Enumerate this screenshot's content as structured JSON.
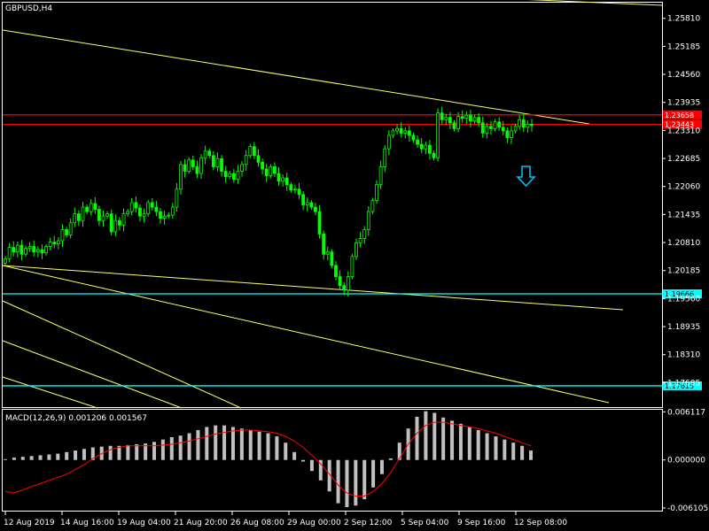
{
  "symbol_title": "GBPUSD,H4",
  "macd_label": "MACD(12,26,9) 0.001206 0.001567",
  "colors": {
    "background": "#000000",
    "frame": "#ffffff",
    "bull": "#00ff00",
    "trendline": "#ffff66",
    "resistance": "#ff0000",
    "support": "#00ffff",
    "macd_hist": "#c0c0c0",
    "macd_signal": "#ff0000",
    "signal_arrow": "#00bfff"
  },
  "chart_data": [
    {
      "type": "candlestick",
      "title": "GBPUSD,H4",
      "ylim": [
        1.1714,
        1.2616
      ],
      "price_ticks": [
        "1.25810",
        "1.25185",
        "1.24560",
        "1.23935",
        "1.23310",
        "1.22685",
        "1.22060",
        "1.21435",
        "1.20810",
        "1.20185",
        "1.19560",
        "1.18935",
        "1.18310",
        "1.17685"
      ],
      "time_ticks": [
        "12 Aug 2019",
        "14 Aug 16:00",
        "19 Aug 04:00",
        "21 Aug 20:00",
        "26 Aug 08:00",
        "29 Aug 00:00",
        "2 Sep 12:00",
        "5 Sep 04:00",
        "9 Sep 16:00",
        "12 Sep 08:00"
      ],
      "close_series": [
        1.2045,
        1.207,
        1.206,
        1.2075,
        1.2055,
        1.2068,
        1.2072,
        1.206,
        1.2065,
        1.2058,
        1.2072,
        1.2082,
        1.2078,
        1.2085,
        1.211,
        1.2098,
        1.2125,
        1.2145,
        1.213,
        1.216,
        1.215,
        1.2168,
        1.2155,
        1.213,
        1.214,
        1.2145,
        1.2105,
        1.213,
        1.212,
        1.2145,
        1.215,
        1.217,
        1.2158,
        1.214,
        1.2145,
        1.217,
        1.216,
        1.215,
        1.2135,
        1.214,
        1.2142,
        1.216,
        1.22,
        1.2255,
        1.224,
        1.2265,
        1.225,
        1.2235,
        1.227,
        1.2285,
        1.2275,
        1.225,
        1.2268,
        1.224,
        1.2228,
        1.2235,
        1.2222,
        1.224,
        1.2255,
        1.2275,
        1.2295,
        1.2275,
        1.226,
        1.2245,
        1.223,
        1.225,
        1.2235,
        1.2218,
        1.2225,
        1.221,
        1.2198,
        1.22,
        1.2188,
        1.2165,
        1.217,
        1.216,
        1.215,
        1.21,
        1.2055,
        1.206,
        1.203,
        1.2005,
        1.1985,
        1.1975,
        1.2005,
        1.205,
        1.208,
        1.209,
        1.211,
        1.215,
        1.2175,
        1.221,
        1.225,
        1.229,
        1.232,
        1.233,
        1.2335,
        1.2325,
        1.233,
        1.232,
        1.231,
        1.23,
        1.229,
        1.2298,
        1.228,
        1.227,
        1.237,
        1.2355,
        1.236,
        1.2348,
        1.2335,
        1.2362,
        1.2358,
        1.2365,
        1.2352,
        1.236,
        1.2348,
        1.2325,
        1.234,
        1.2335,
        1.235,
        1.2338,
        1.233,
        1.2315,
        1.233,
        1.234,
        1.2355,
        1.2338,
        1.2345,
        1.2342
      ]
    },
    {
      "type": "bar",
      "title": "MACD(12,26,9) 0.001206 0.001567",
      "ylim": [
        -0.00645,
        0.00639
      ],
      "y_ticks": [
        "0.006117",
        "0.000000",
        "-0.006105"
      ],
      "macd_line": [
        0.0001,
        0.0003,
        0.0004,
        0.0005,
        0.0006,
        0.0007,
        0.0008,
        0.001,
        0.0012,
        0.0014,
        0.0016,
        0.0017,
        0.0018,
        0.0018,
        0.0019,
        0.002,
        0.0021,
        0.0023,
        0.0026,
        0.0029,
        0.0031,
        0.0034,
        0.0038,
        0.0042,
        0.0044,
        0.0044,
        0.0042,
        0.004,
        0.0038,
        0.0036,
        0.0034,
        0.003,
        0.0022,
        0.001,
        -0.0002,
        -0.0014,
        -0.0026,
        -0.004,
        -0.0055,
        -0.006,
        -0.0058,
        -0.005,
        -0.0035,
        -0.0018,
        0.0002,
        0.0022,
        0.004,
        0.0055,
        0.0062,
        0.006,
        0.0054,
        0.005,
        0.0046,
        0.0042,
        0.0038,
        0.0034,
        0.003,
        0.0026,
        0.0022,
        0.0018,
        0.0012
      ],
      "signal_line": [
        -0.004,
        -0.0042,
        -0.0038,
        -0.0034,
        -0.003,
        -0.0026,
        -0.0022,
        -0.0018,
        -0.0012,
        -0.0006,
        0.0002,
        0.0008,
        0.0013,
        0.0016,
        0.0018,
        0.0018,
        0.0018,
        0.0018,
        0.0019,
        0.002,
        0.0022,
        0.0024,
        0.0027,
        0.003,
        0.0033,
        0.0035,
        0.0037,
        0.0038,
        0.0038,
        0.0037,
        0.0036,
        0.0034,
        0.003,
        0.0024,
        0.0016,
        0.0006,
        -0.0005,
        -0.0018,
        -0.0032,
        -0.0042,
        -0.0046,
        -0.0046,
        -0.004,
        -0.003,
        -0.0016,
        0.0002,
        0.002,
        0.0034,
        0.0044,
        0.0048,
        0.0048,
        0.0046,
        0.0044,
        0.0042,
        0.004,
        0.0037,
        0.0034,
        0.003,
        0.0026,
        0.0022,
        0.0018
      ]
    }
  ],
  "price_tags": [
    {
      "label": "1.23658",
      "price": 1.23658,
      "color": "#ff0000"
    },
    {
      "label": "1.23443",
      "price": 1.23443,
      "color": "#ff0000"
    },
    {
      "label": "1.19666",
      "price": 1.19666,
      "color": "#00ffff"
    },
    {
      "label": "1.17615",
      "price": 1.17615,
      "color": "#00ffff"
    }
  ]
}
